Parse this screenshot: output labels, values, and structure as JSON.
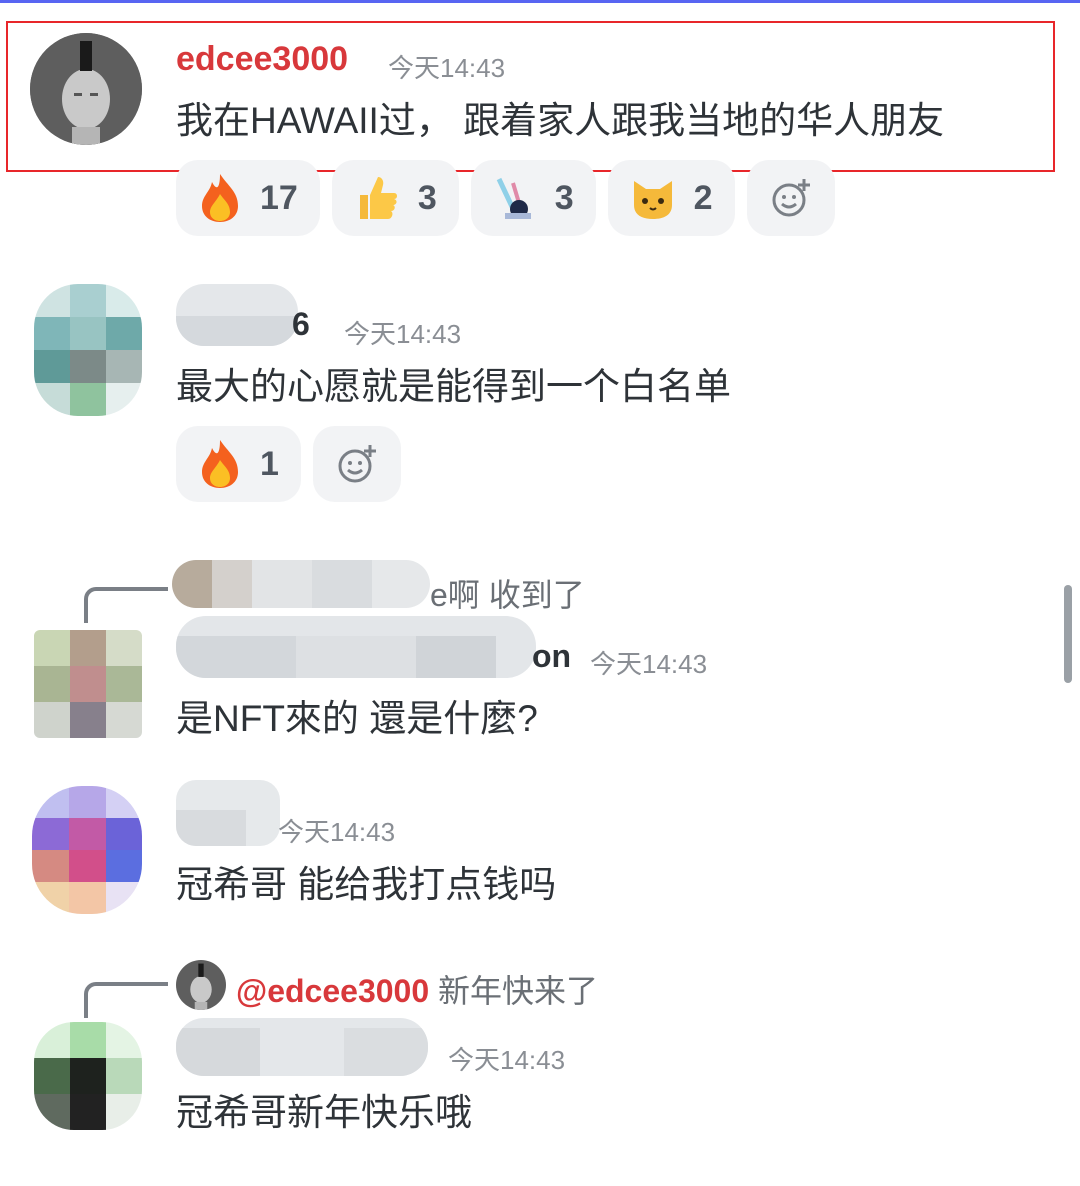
{
  "accent_color": "#d8383b",
  "messages": [
    {
      "username": "edcee3000",
      "time": "今天14:43",
      "text": "我在HAWAII过， 跟着家人跟我当地的华人朋友",
      "reactions": [
        {
          "icon": "fire-emoji",
          "count": "17"
        },
        {
          "icon": "thumbs-up-emoji",
          "count": "3"
        },
        {
          "icon": "custom-sticker-emoji",
          "count": "3"
        },
        {
          "icon": "cat-face-emoji",
          "count": "2"
        }
      ]
    },
    {
      "username_visible_fragment": "6",
      "time": "今天14:43",
      "text": "最大的心愿就是能得到一个白名单",
      "reactions": [
        {
          "icon": "fire-emoji",
          "count": "1"
        }
      ]
    },
    {
      "reply_preview": "e啊 收到了",
      "username_visible_fragment": "on",
      "time": "今天14:43",
      "text": "是NFT來的 還是什麼?"
    },
    {
      "time": "今天14:43",
      "text": "冠希哥 能给我打点钱吗"
    },
    {
      "reply_mention": "@edcee3000",
      "reply_preview": "新年快来了",
      "time": "今天14:43",
      "text": "冠希哥新年快乐哦"
    }
  ]
}
